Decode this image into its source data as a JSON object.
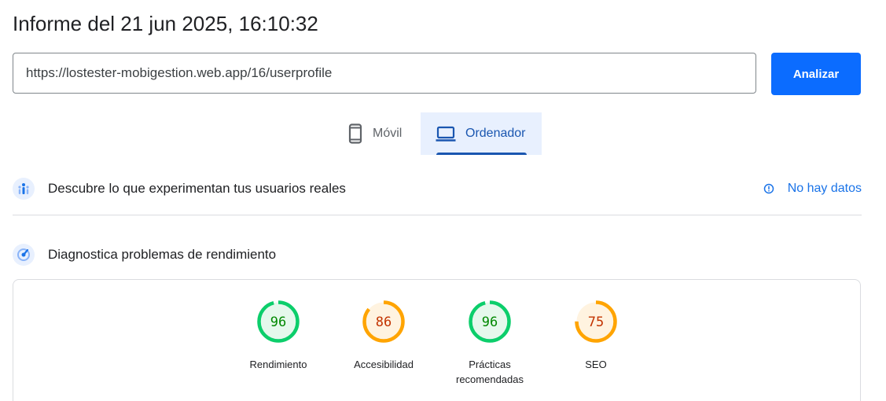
{
  "header": {
    "title": "Informe del 21 jun 2025, 16:10:32"
  },
  "search": {
    "value": "https://lostester-mobigestion.web.app/16/userprofile",
    "analyze_label": "Analizar"
  },
  "tabs": [
    {
      "label": "Móvil",
      "icon": "smartphone-icon",
      "selected": false
    },
    {
      "label": "Ordenador",
      "icon": "laptop-icon",
      "selected": true
    }
  ],
  "field_data": {
    "title": "Descubre lo que experimentan tus usuarios reales",
    "icon": "users-icon",
    "no_data_label": "No hay datos",
    "no_data_icon": "info-icon"
  },
  "lab_data": {
    "title": "Diagnostica problemas de rendimiento",
    "icon": "gauge-icon"
  },
  "scores": [
    {
      "label": "Rendimiento",
      "value": 96,
      "status": "good"
    },
    {
      "label": "Accesibilidad",
      "value": 86,
      "status": "average"
    },
    {
      "label": "Prácticas recomendadas",
      "value": 96,
      "status": "good"
    },
    {
      "label": "SEO",
      "value": 75,
      "status": "average"
    }
  ],
  "colors": {
    "accent": "#1a73e8",
    "button": "#0b6cff",
    "good_stroke": "#0cce6b",
    "good_fill": "#e5f8ec",
    "good_text": "#008800",
    "average_stroke": "#ffa400",
    "average_fill": "#fff3e0",
    "average_text": "#c33300"
  }
}
